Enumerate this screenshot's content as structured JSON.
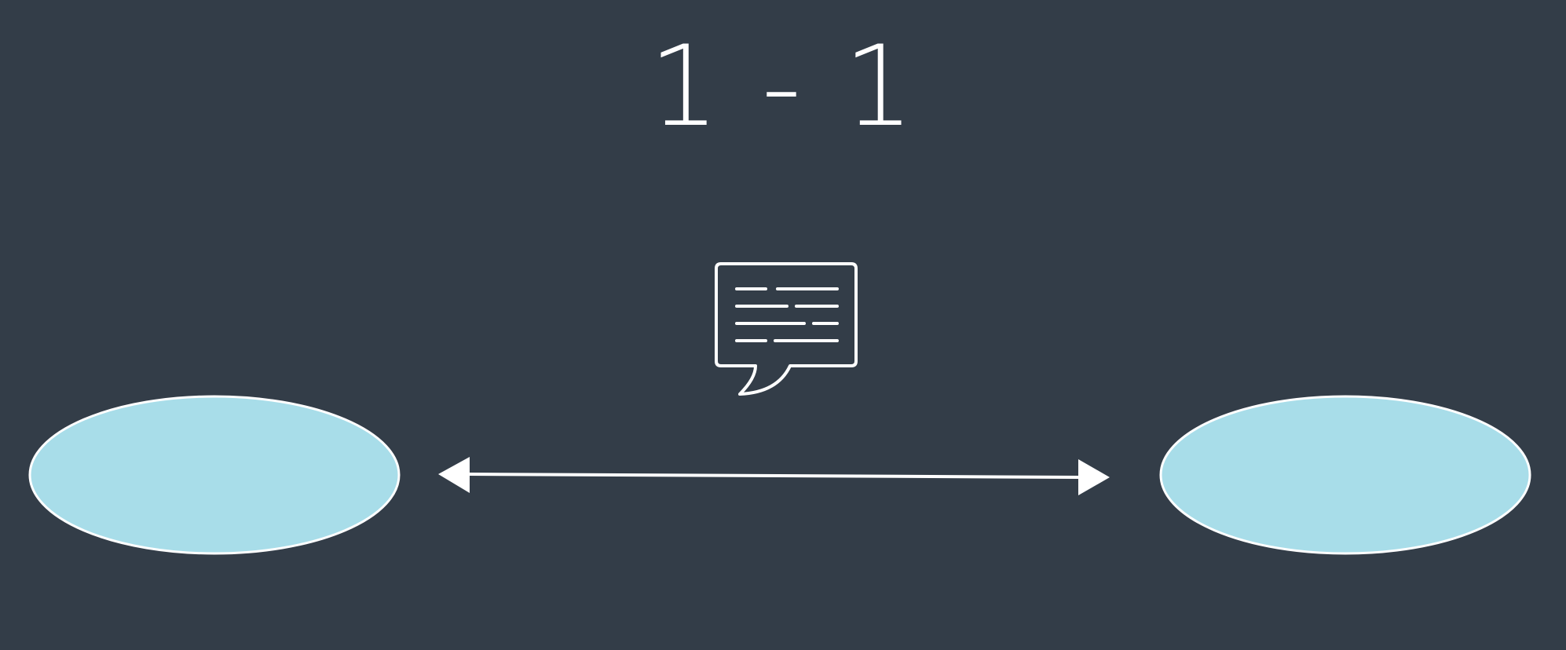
{
  "title": "1 - 1",
  "colors": {
    "background": "#333d48",
    "node_fill": "#a8dde9",
    "stroke": "#ffffff"
  },
  "icons": {
    "message": "speech-bubble-message-icon",
    "connector": "double-headed-arrow-icon"
  }
}
